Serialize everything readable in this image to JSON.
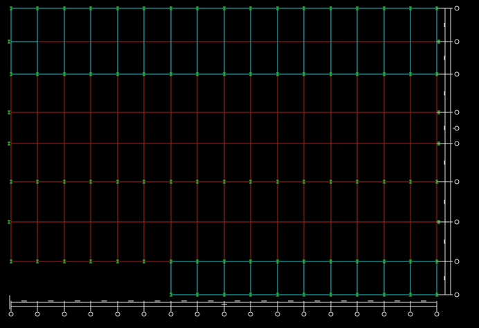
{
  "colors": {
    "background": "#000000",
    "beam": "#b21f1f",
    "bay": "#21c7c7",
    "node": "#2ee82e",
    "axis": "#e6e6e6"
  },
  "icons": {
    "node_marker": "node-marker-icon",
    "axis_bubble": "axis-bubble-icon"
  },
  "grid": {
    "column_count": 17,
    "row_count": 9
  }
}
